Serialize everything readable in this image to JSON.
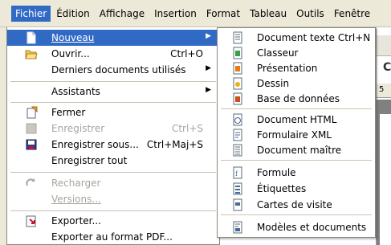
{
  "menubar": [
    "Fichier",
    "Édition",
    "Affichage",
    "Insertion",
    "Format",
    "Tableau",
    "Outils",
    "Fenêtre"
  ],
  "file_menu": [
    {
      "label": "Nouveau",
      "shortcut": "",
      "icon": "new-document-icon",
      "submenu": true,
      "highlighted": true,
      "disabled": false
    },
    {
      "label": "Ouvrir...",
      "shortcut": "Ctrl+O",
      "icon": "open-folder-icon",
      "submenu": false,
      "disabled": false
    },
    {
      "label": "Derniers documents utilisés",
      "shortcut": "",
      "icon": "",
      "submenu": true,
      "disabled": false
    },
    {
      "label": "Assistants",
      "shortcut": "",
      "icon": "",
      "submenu": true,
      "disabled": false
    },
    {
      "label": "Fermer",
      "shortcut": "",
      "icon": "close-document-icon",
      "submenu": false,
      "disabled": false
    },
    {
      "label": "Enregistrer",
      "shortcut": "Ctrl+S",
      "icon": "save-icon",
      "submenu": false,
      "disabled": true
    },
    {
      "label": "Enregistrer sous...",
      "shortcut": "Ctrl+Maj+S",
      "icon": "save-as-icon",
      "submenu": false,
      "disabled": false
    },
    {
      "label": "Enregistrer tout",
      "shortcut": "",
      "icon": "",
      "submenu": false,
      "disabled": false
    },
    {
      "label": "Recharger",
      "shortcut": "",
      "icon": "reload-icon",
      "submenu": false,
      "disabled": true
    },
    {
      "label": "Versions...",
      "shortcut": "",
      "icon": "",
      "submenu": false,
      "disabled": true
    },
    {
      "label": "Exporter...",
      "shortcut": "",
      "icon": "export-icon",
      "submenu": false,
      "disabled": false
    },
    {
      "label": "Exporter au format PDF...",
      "shortcut": "",
      "icon": "",
      "submenu": false,
      "disabled": false
    }
  ],
  "new_submenu": [
    {
      "label": "Document texte  Ctrl+N",
      "icon": "text-document-icon"
    },
    {
      "label": "Classeur",
      "icon": "spreadsheet-icon"
    },
    {
      "label": "Présentation",
      "icon": "presentation-icon"
    },
    {
      "label": "Dessin",
      "icon": "drawing-icon"
    },
    {
      "label": "Base de données",
      "icon": "database-icon"
    },
    {
      "label": "Document HTML",
      "icon": "html-document-icon"
    },
    {
      "label": "Formulaire XML",
      "icon": "xml-form-icon"
    },
    {
      "label": "Document maître",
      "icon": "master-document-icon"
    },
    {
      "label": "Formule",
      "icon": "formula-icon"
    },
    {
      "label": "Étiquettes",
      "icon": "labels-icon"
    },
    {
      "label": "Cartes de visite",
      "icon": "business-cards-icon"
    },
    {
      "label": "Modèles et documents",
      "icon": "templates-icon"
    }
  ],
  "background": {
    "glyph": "C",
    "ruler_digit": "5"
  },
  "colors": {
    "highlight": "#316ac5",
    "menubar": "#ece9d8",
    "disabled": "#a7a69e"
  }
}
